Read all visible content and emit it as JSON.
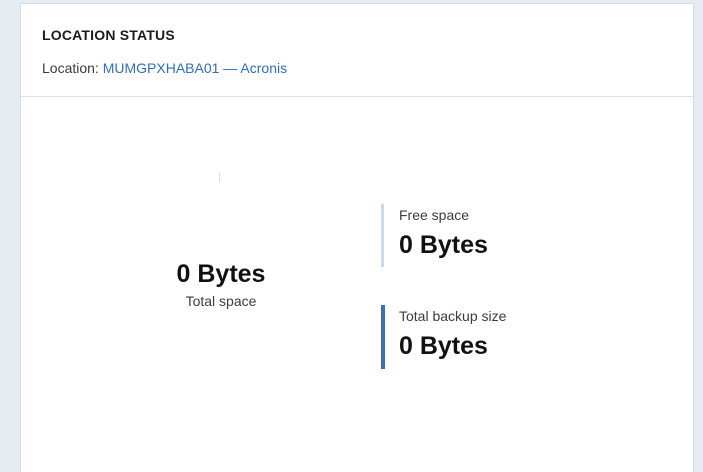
{
  "panel": {
    "title": "LOCATION STATUS",
    "location_prefix": "Location: ",
    "location_name": "MUMGPXHABA01 — Acronis"
  },
  "summary": {
    "total_value": "0 Bytes",
    "total_label": "Total space"
  },
  "stats": {
    "free_label": "Free space",
    "free_value": "0 Bytes",
    "backup_label": "Total backup size",
    "backup_value": "0 Bytes"
  },
  "colors": {
    "accent": "#3d6fb6",
    "free_bar": "#c9d8ef",
    "link": "#2f6fbf"
  }
}
